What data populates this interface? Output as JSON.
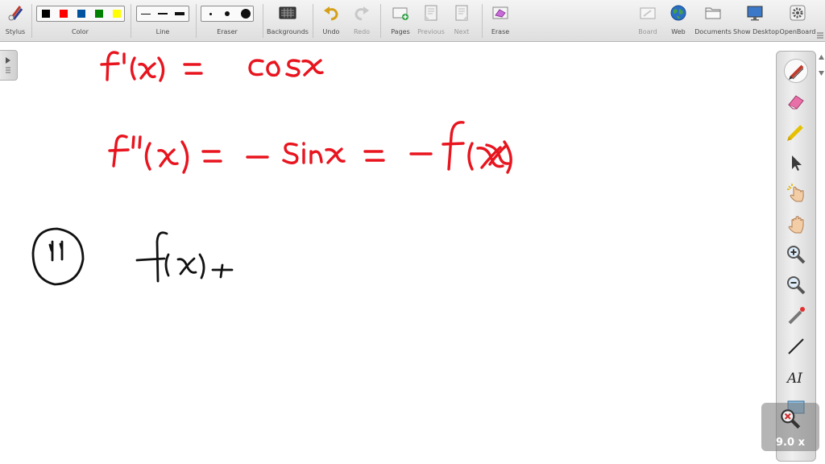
{
  "toolbar": {
    "stylus_label": "Stylus",
    "color_label": "Color",
    "line_label": "Line",
    "eraser_label": "Eraser",
    "backgrounds_label": "Backgrounds",
    "undo_label": "Undo",
    "redo_label": "Redo",
    "pages_label": "Pages",
    "previous_label": "Previous",
    "next_label": "Next",
    "erase_label": "Erase",
    "board_label": "Board",
    "web_label": "Web",
    "documents_label": "Documents",
    "show_desktop_label": "Show Desktop",
    "openboard_label": "OpenBoard",
    "colors": [
      "#000000",
      "#ff0000",
      "#00549f",
      "#008000",
      "#ffff00"
    ]
  },
  "palette": {
    "tools": [
      "pen-icon",
      "eraser-icon",
      "marker-icon",
      "selector-icon",
      "play-hand-icon",
      "hand-icon",
      "zoom-in-icon",
      "zoom-out-icon",
      "laser-pointer-icon",
      "line-icon",
      "text-icon",
      "capture-icon"
    ],
    "text_tool_label": "AI"
  },
  "zoom": {
    "value": "9.0 x"
  },
  "board": {
    "ink_red": "#e8141e",
    "ink_black": "#111111"
  }
}
